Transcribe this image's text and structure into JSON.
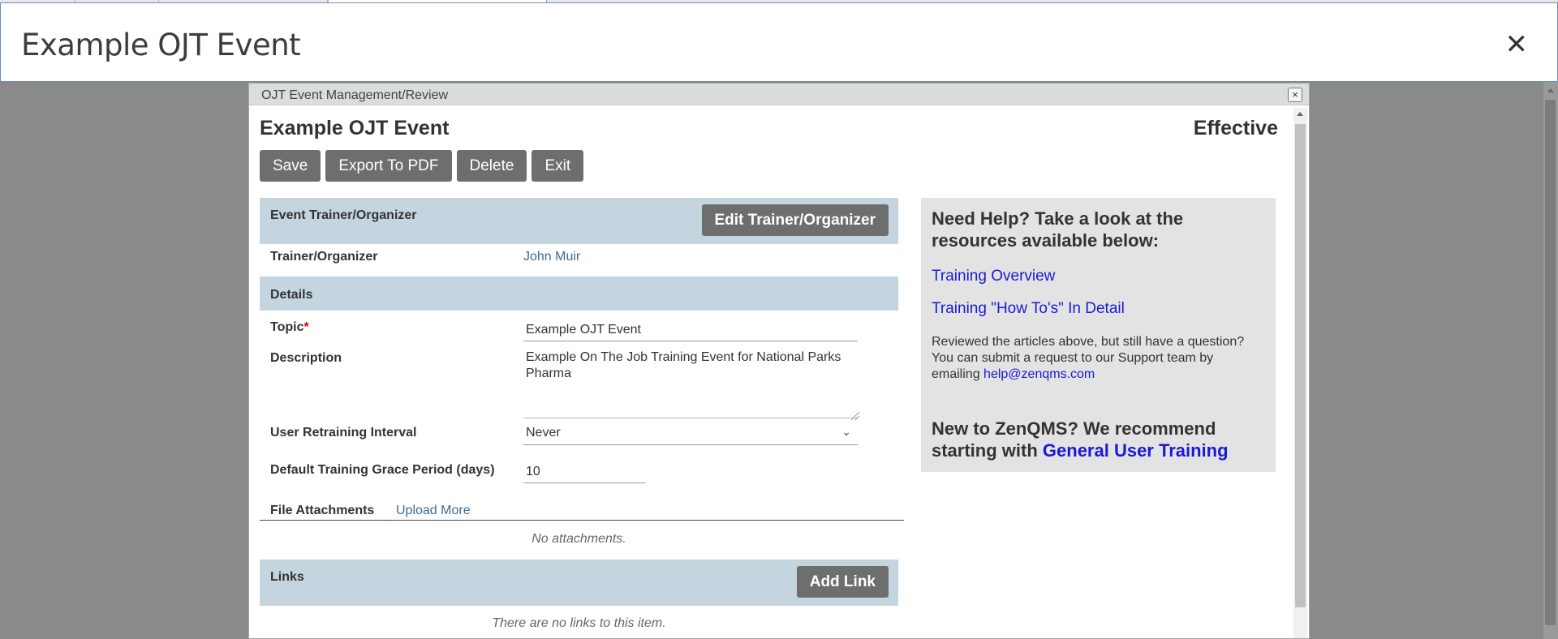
{
  "modal": {
    "title": "Example OJT Event",
    "close_glyph": "✕"
  },
  "dialog": {
    "titlebar": "OJT Event Management/Review",
    "close_glyph": "×",
    "doc_title": "Example OJT Event",
    "status": "Effective"
  },
  "toolbar": {
    "save": "Save",
    "export": "Export To PDF",
    "delete": "Delete",
    "exit": "Exit"
  },
  "trainer_section": {
    "header": "Event Trainer/Organizer",
    "edit_button": "Edit Trainer/Organizer",
    "label": "Trainer/Organizer",
    "value": "John Muir"
  },
  "details": {
    "header": "Details",
    "topic_label": "Topic",
    "required_mark": "*",
    "topic_value": "Example OJT Event",
    "description_label": "Description",
    "description_value": "Example On The Job Training Event for National Parks Pharma",
    "retraining_label": "User Retraining Interval",
    "retraining_value": "Never",
    "grace_label": "Default Training Grace Period (days)",
    "grace_value": "10"
  },
  "attachments": {
    "label": "File Attachments",
    "upload_link": "Upload More",
    "empty": "No attachments."
  },
  "links": {
    "header": "Links",
    "add_button": "Add Link",
    "empty": "There are no links to this item."
  },
  "help": {
    "heading": "Need Help? Take a look at the resources available below:",
    "link1": "Training Overview",
    "link2": "Training \"How To's\" In Detail",
    "body": "Reviewed the articles above, but still have a question? You can submit a request to our Support team by emailing",
    "email": "help@zenqms.com",
    "new_prefix": "New to ZenQMS? We recommend starting with",
    "new_link": "General User Training"
  },
  "colors": {
    "section_header_bg": "#c5d5df",
    "button_bg": "#6e6e6e",
    "help_bg": "#e3e3e3",
    "link_blue": "#1a1ad6",
    "field_link": "#3d6b96"
  }
}
